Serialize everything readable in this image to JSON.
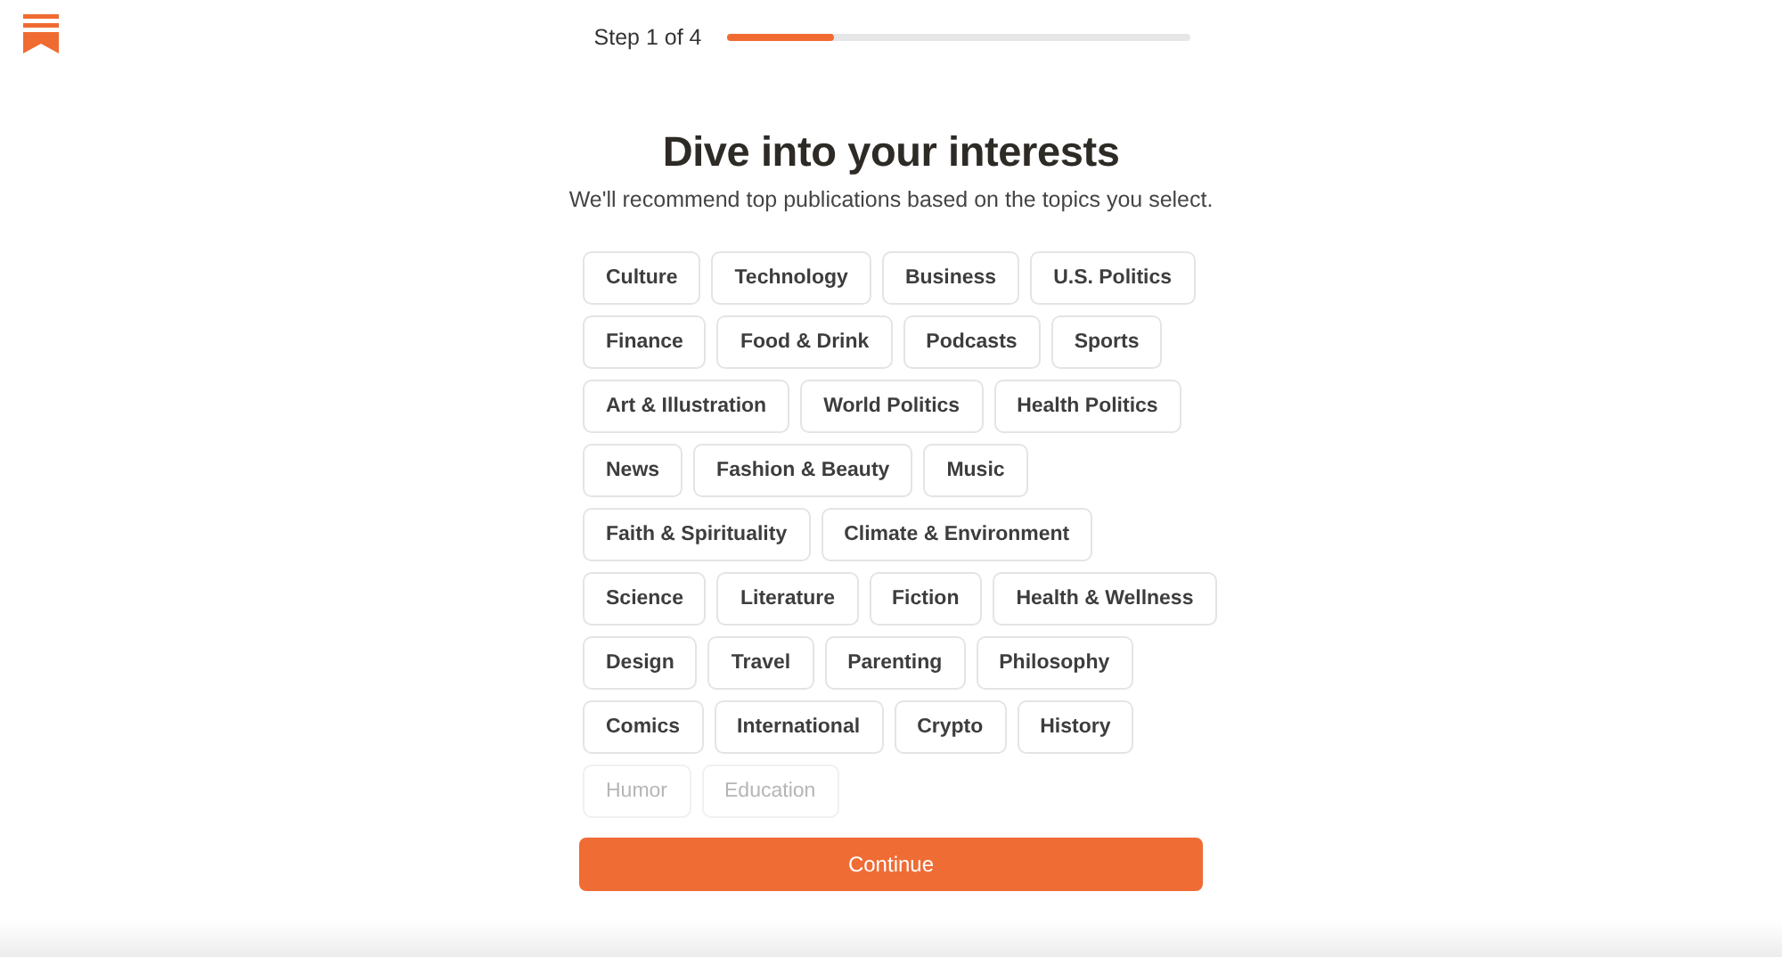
{
  "progress": {
    "label": "Step 1 of 4",
    "level": 0.23
  },
  "heading": "Dive into your interests",
  "subheading": "We'll recommend top publications based on the topics you select.",
  "topic_rows": [
    [
      {
        "label": "Culture",
        "dimmed": false
      },
      {
        "label": "Technology",
        "dimmed": false
      },
      {
        "label": "Business",
        "dimmed": false
      },
      {
        "label": "U.S. Politics",
        "dimmed": false
      }
    ],
    [
      {
        "label": "Finance",
        "dimmed": false
      },
      {
        "label": "Food & Drink",
        "dimmed": false
      },
      {
        "label": "Podcasts",
        "dimmed": false
      },
      {
        "label": "Sports",
        "dimmed": false
      }
    ],
    [
      {
        "label": "Art & Illustration",
        "dimmed": false
      },
      {
        "label": "World Politics",
        "dimmed": false
      },
      {
        "label": "Health Politics",
        "dimmed": false
      }
    ],
    [
      {
        "label": "News",
        "dimmed": false
      },
      {
        "label": "Fashion & Beauty",
        "dimmed": false
      },
      {
        "label": "Music",
        "dimmed": false
      }
    ],
    [
      {
        "label": "Faith & Spirituality",
        "dimmed": false
      },
      {
        "label": "Climate & Environment",
        "dimmed": false
      }
    ],
    [
      {
        "label": "Science",
        "dimmed": false
      },
      {
        "label": "Literature",
        "dimmed": false
      },
      {
        "label": "Fiction",
        "dimmed": false
      },
      {
        "label": "Health & Wellness",
        "dimmed": false
      }
    ],
    [
      {
        "label": "Design",
        "dimmed": false
      },
      {
        "label": "Travel",
        "dimmed": false
      },
      {
        "label": "Parenting",
        "dimmed": false
      },
      {
        "label": "Philosophy",
        "dimmed": false
      }
    ],
    [
      {
        "label": "Comics",
        "dimmed": false
      },
      {
        "label": "International",
        "dimmed": false
      },
      {
        "label": "Crypto",
        "dimmed": false
      },
      {
        "label": "History",
        "dimmed": false
      }
    ],
    [
      {
        "label": "Humor",
        "dimmed": true
      },
      {
        "label": "Education",
        "dimmed": true
      }
    ]
  ],
  "continue_button": "Continue"
}
